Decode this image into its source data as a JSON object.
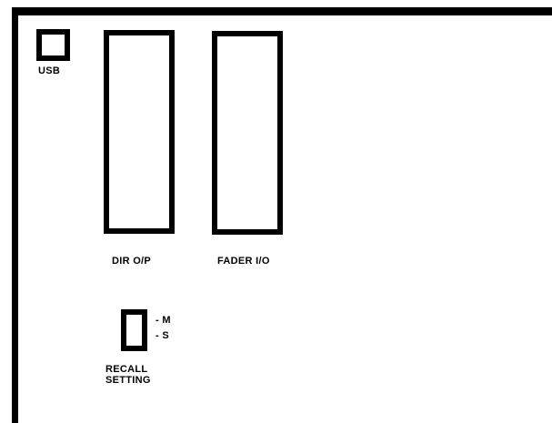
{
  "panel": {
    "usb_label": "USB",
    "dir_op_label": "DIR O/P",
    "fader_io_label": "FADER I/O",
    "switch_m_label": "- M",
    "switch_s_label": "- S",
    "recall_line1": "RECALL",
    "recall_line2": "SETTING"
  }
}
